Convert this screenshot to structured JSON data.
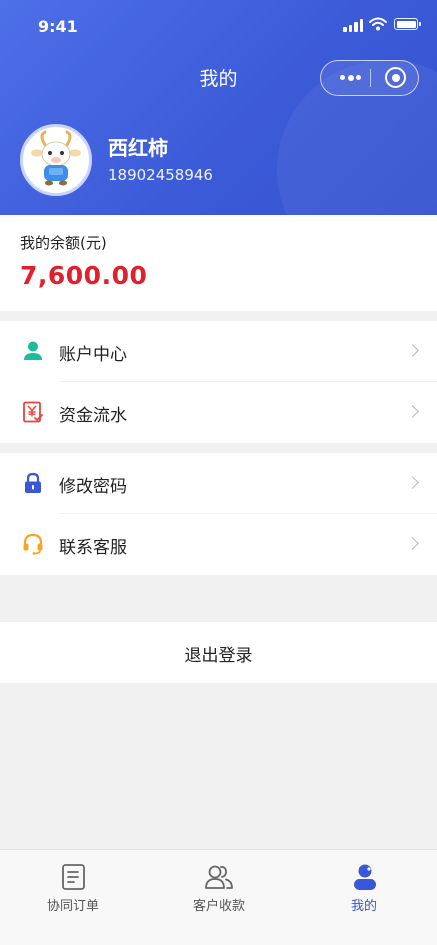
{
  "status_bar": {
    "time": "9:41"
  },
  "nav": {
    "title": "我的"
  },
  "profile": {
    "name": "西红柿",
    "phone": "18902458946"
  },
  "balance": {
    "label": "我的余额(元)",
    "amount": "7,600.00"
  },
  "menu_group_1": [
    {
      "label": "账户中心",
      "icon": "person-icon",
      "color": "#1abc9c"
    },
    {
      "label": "资金流水",
      "icon": "receipt-yuan-icon",
      "color": "#e8433a"
    }
  ],
  "menu_group_2": [
    {
      "label": "修改密码",
      "icon": "lock-icon",
      "color": "#3a57d6"
    },
    {
      "label": "联系客服",
      "icon": "headset-icon",
      "color": "#f5a623"
    }
  ],
  "logout": {
    "label": "退出登录"
  },
  "tabbar": {
    "items": [
      {
        "label": "协同订单",
        "icon": "document-icon",
        "active": false
      },
      {
        "label": "客户收款",
        "icon": "users-icon",
        "active": false
      },
      {
        "label": "我的",
        "icon": "profile-icon",
        "active": true
      }
    ]
  },
  "colors": {
    "primary": "#3a57d6",
    "amount": "#e0202a"
  }
}
